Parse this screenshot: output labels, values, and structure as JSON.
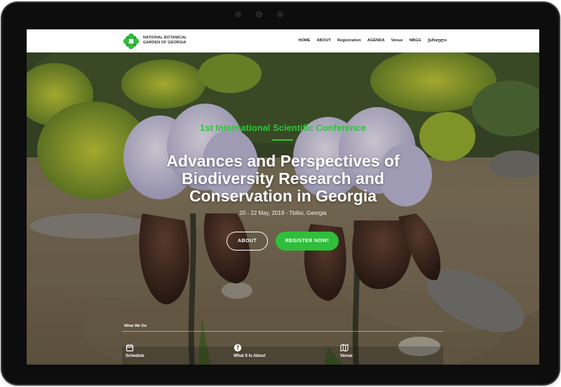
{
  "brand": {
    "name_line1": "NATIONAL BOTANICAL",
    "name_line2": "GARDEN OF GEORGIA",
    "logo_color": "#2fbf3b"
  },
  "nav": {
    "items": [
      "HOME",
      "ABOUT",
      "Registration",
      "AGENDA",
      "Venue",
      "NBGG",
      "ქართული"
    ]
  },
  "hero": {
    "kicker": "1st International Scientific Conference",
    "title_line1": "Advances and Perspectives of",
    "title_line2": "Biodiversity Research and",
    "title_line3": "Conservation in Georgia",
    "dates": "20 - 22 May, 2019 - Tbilisi, Georgia",
    "about_button": "ABOUT",
    "register_button": "REGISTER NOW!",
    "accent_color": "#31c43a"
  },
  "what_we_do": {
    "label": "What We Do",
    "features": [
      {
        "label": "Schedule",
        "icon": "calendar-icon"
      },
      {
        "label": "What It Is About",
        "icon": "question-icon"
      },
      {
        "label": "Venue",
        "icon": "map-icon"
      }
    ]
  }
}
